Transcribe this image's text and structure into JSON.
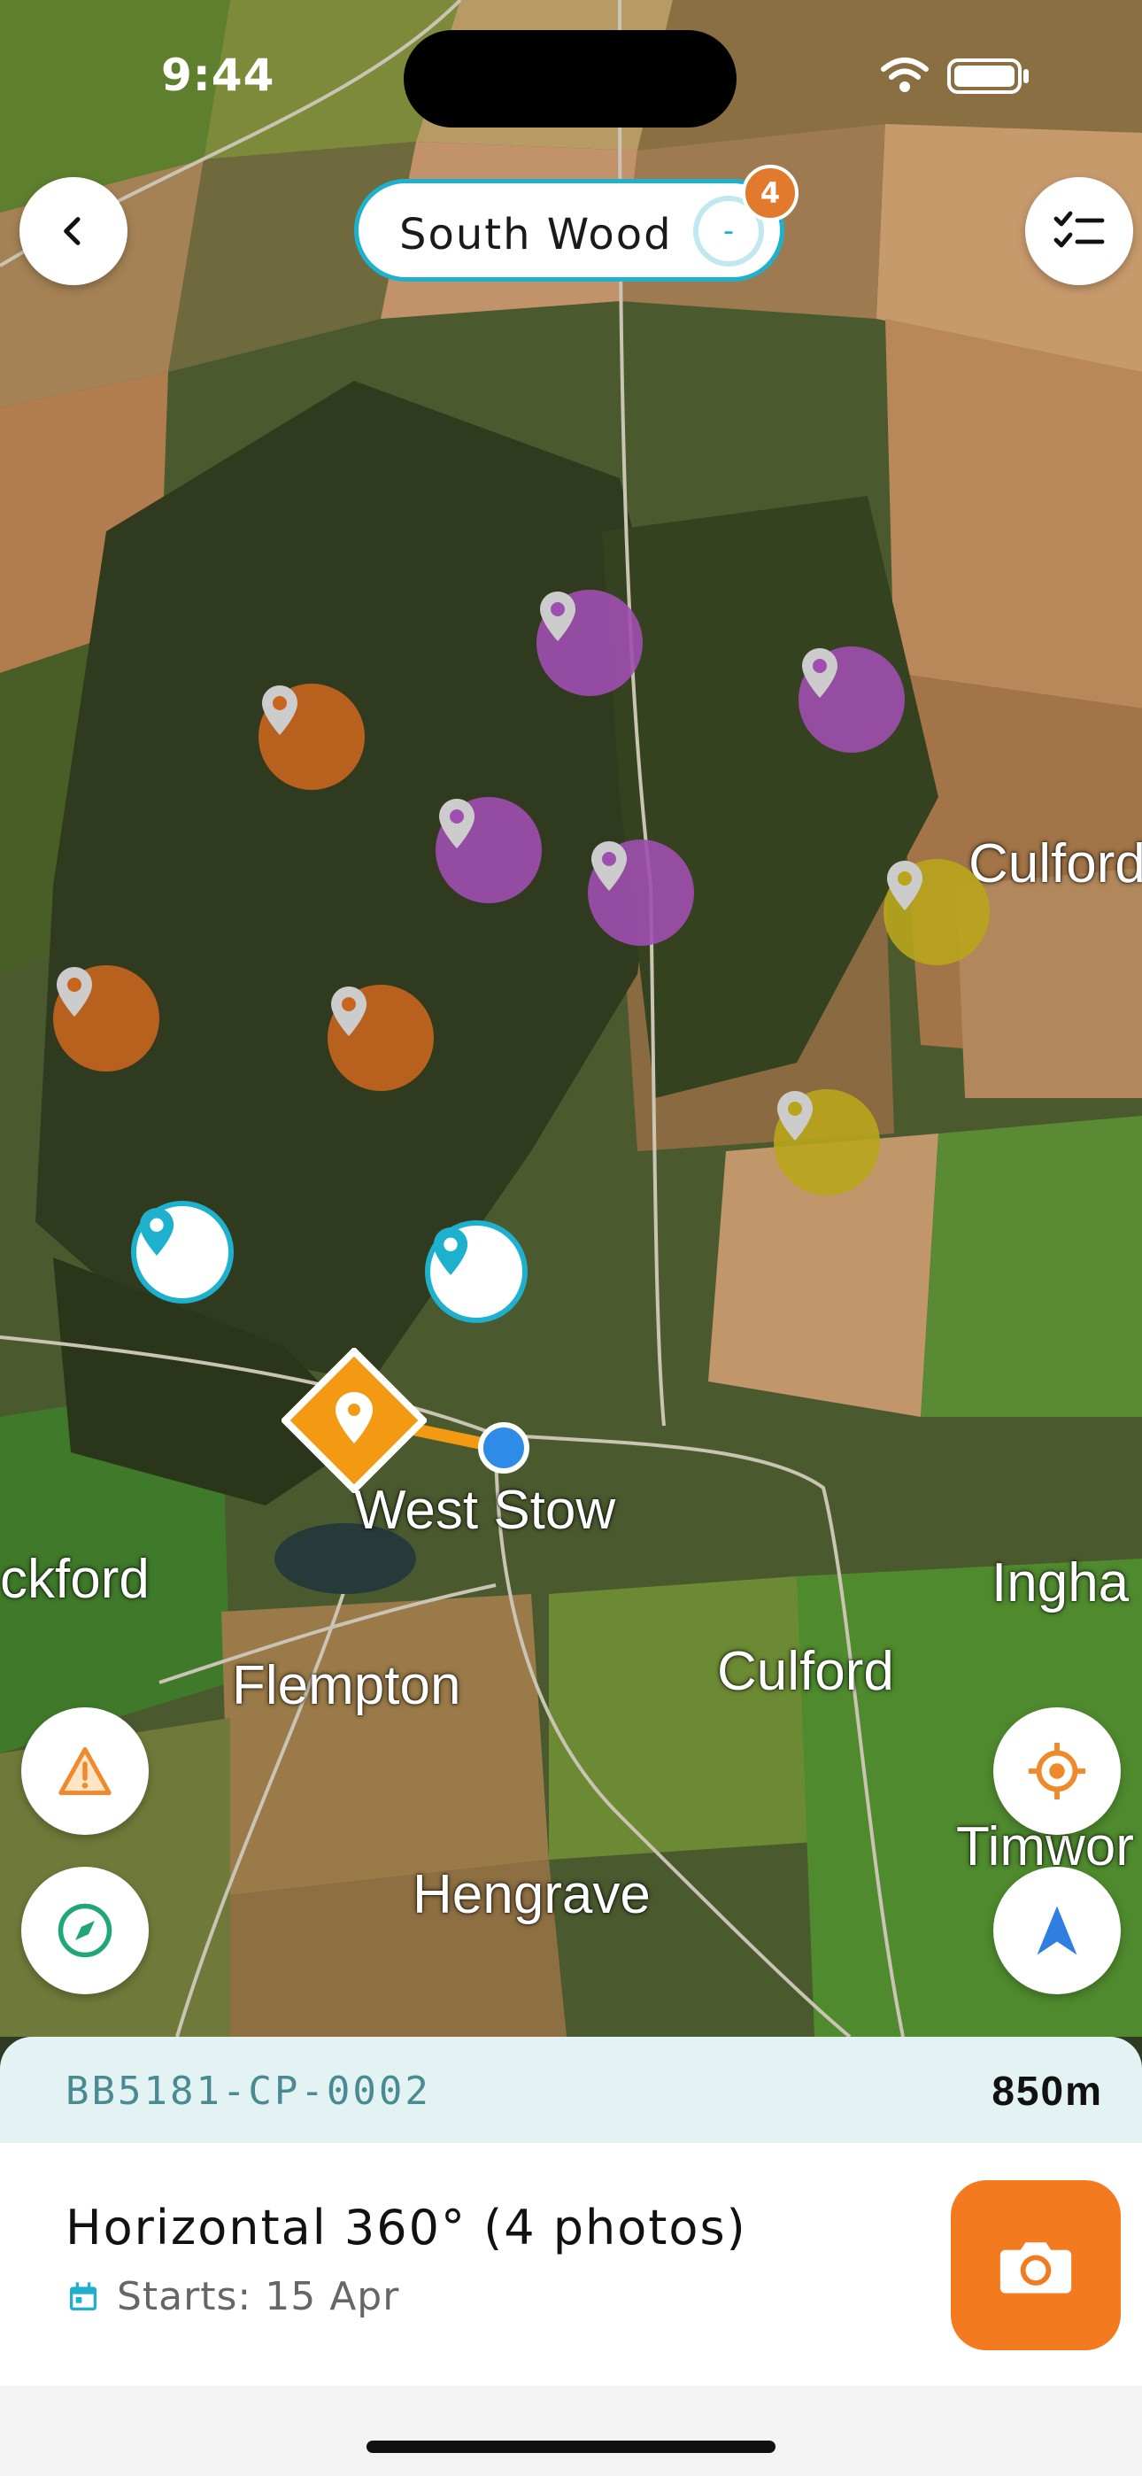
{
  "status_bar": {
    "time": "9:44"
  },
  "header": {
    "back_icon": "chevron-left-icon",
    "site_name": "South Wood",
    "site_indicator": "-",
    "badge_count": "4",
    "checklist_icon": "checklist-icon",
    "colors": {
      "accent": "#1eb1cd",
      "badge": "#e27a2e"
    }
  },
  "map": {
    "labels": [
      "Culford",
      "West Stow",
      "ckford",
      "Flempton",
      "Culford",
      "Ingha",
      "Timwor",
      "Hengrave"
    ],
    "marker_colors": {
      "purple": "#a04fb0",
      "orange": "#c8661f",
      "yellow": "#b9a51c",
      "cyan": "#1eb1cd",
      "selected": "#f39a12",
      "user": "#2e8be8"
    }
  },
  "map_controls": {
    "warning_icon": "warning-icon",
    "compass_icon": "compass-icon",
    "locate_icon": "locate-target-icon",
    "navigate_icon": "navigation-arrow-icon"
  },
  "bottom_sheet": {
    "code": "BB5181-CP-0002",
    "distance": "850m",
    "task_title": "Horizontal 360° (4 photos)",
    "task_date": "Starts: 15 Apr",
    "calendar_icon": "calendar-icon",
    "camera_icon": "camera-icon",
    "colors": {
      "camera": "#f47a20",
      "header_bg": "#e3f3f4"
    }
  }
}
